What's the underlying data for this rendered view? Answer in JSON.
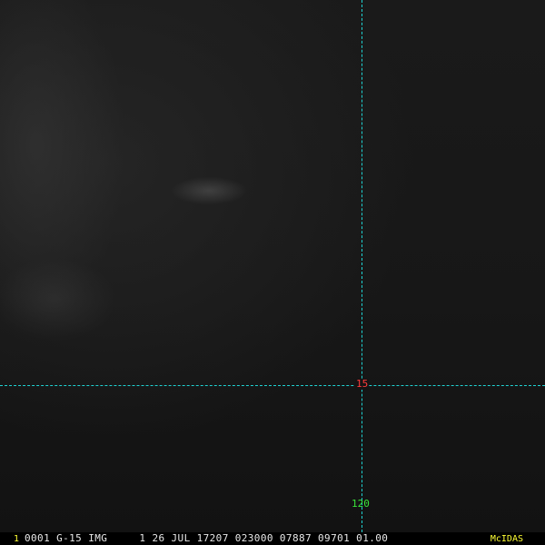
{
  "overlay": {
    "latitude_label": "15",
    "longitude_label": "120",
    "gridline_color": "#1fd3d3",
    "latitude_label_color": "#ff3b3b",
    "longitude_label_color": "#39e639"
  },
  "status_bar": {
    "frame_number": "1",
    "info": "0001 G-15 IMG     1 26 JUL 17207 023000 07887 09701 01.00",
    "brand": "McIDAS",
    "brand_color": "#ffff33"
  }
}
